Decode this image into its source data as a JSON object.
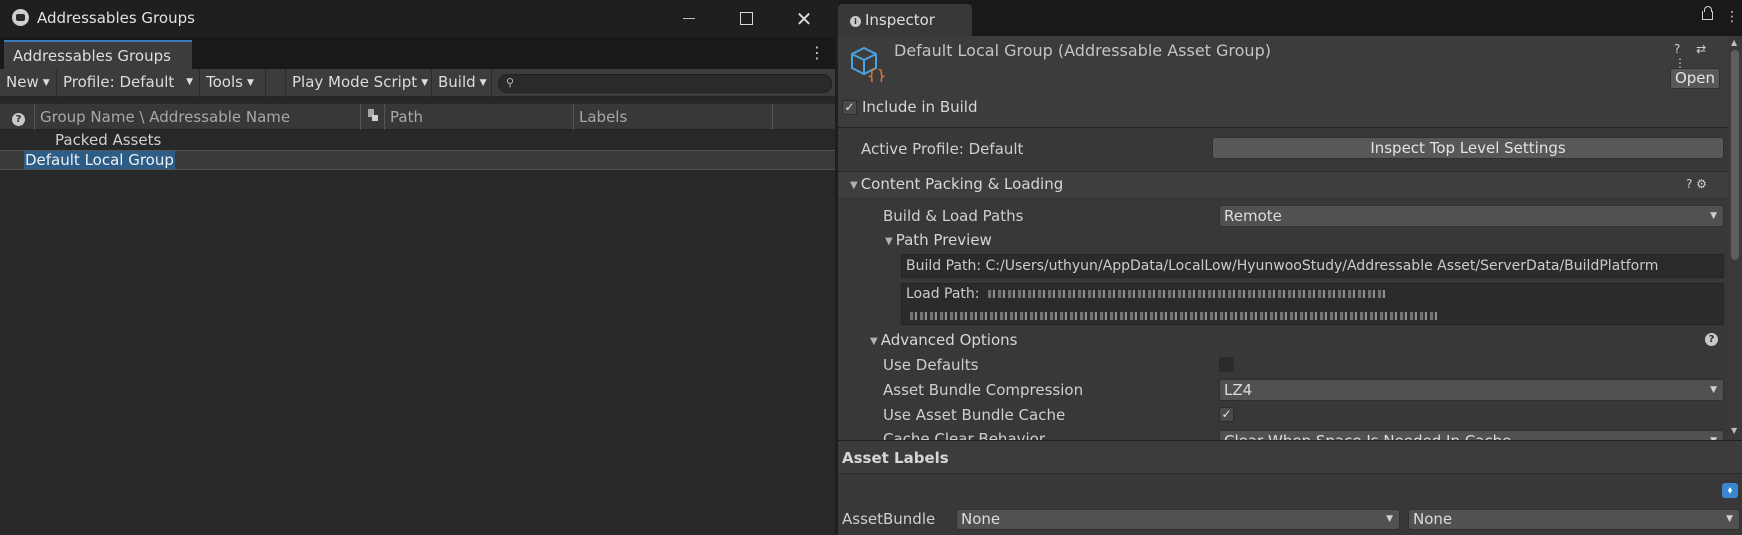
{
  "left_window": {
    "title": "Addressables Groups",
    "close_glyph": "✕",
    "tab_label": "Addressables Groups",
    "kebab_glyph": "⋮",
    "toolbar": {
      "new": "New",
      "profile": "Profile: Default",
      "tools": "Tools",
      "play_mode": "Play Mode Script",
      "build": "Build",
      "caret": "▼",
      "search_placeholder": "",
      "search_glyph": "⚲"
    },
    "columns": {
      "help_glyph": "?",
      "name": "Group Name \\ Addressable Name",
      "path": "Path",
      "labels": "Labels"
    },
    "rows": [
      "Packed Assets",
      "Default Local Group"
    ]
  },
  "inspector": {
    "tab_label": "Inspector",
    "info_glyph": "i",
    "kebab_glyph": "⋮",
    "header_icons": "? ⇄ ⋮",
    "asset_title": "Default Local Group (Addressable Asset Group)",
    "open_label": "Open",
    "include_in_build": {
      "label": "Include in Build",
      "checked": true,
      "check_glyph": "✓"
    },
    "active_profile_label": "Active Profile: Default",
    "inspect_top_level_label": "Inspect Top Level Settings",
    "content_packing": {
      "title": "Content Packing & Loading",
      "icons": "? ⚙",
      "build_load_paths_label": "Build & Load Paths",
      "build_load_paths_value": "Remote",
      "path_preview": "Path Preview",
      "build_path": "Build Path: C:/Users/uthyun/AppData/LocalLow/HyunwooStudy/Addressable Asset/ServerData/BuildPlatform",
      "load_path_label": "Load Path:"
    },
    "advanced": {
      "title": "Advanced Options",
      "help_glyph": "?",
      "use_defaults_label": "Use Defaults",
      "use_defaults_checked": false,
      "compression_label": "Asset Bundle Compression",
      "compression_value": "LZ4",
      "cache_label": "Use Asset Bundle Cache",
      "cache_checked": true,
      "check_glyph": "✓",
      "cache_clear_label": "Cache Clear Behavior",
      "cache_clear_value": "Clear When Space Is Needed In Cache"
    },
    "triangle_down": "▼",
    "asset_labels": {
      "title": "Asset Labels",
      "tag_glyph": "⬧",
      "assetbundle_label": "AssetBundle",
      "assetbundle_value": "None",
      "variant_value": "None"
    },
    "scroll_up": "▲",
    "scroll_down": "▼"
  },
  "colors": {
    "selection": "#2c5d87",
    "tab_accent": "#3a79bb",
    "asset_icon_blue": "#4aa3e0",
    "asset_icon_orange": "#e8742c"
  }
}
